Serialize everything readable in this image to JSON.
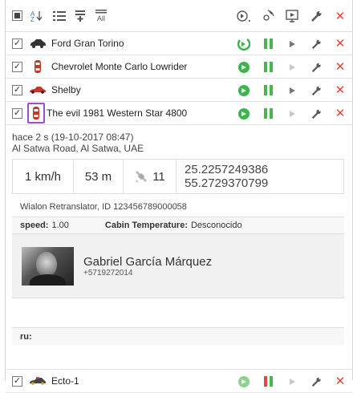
{
  "toolbar": {
    "left_icons": [
      "select-all-checkbox-icon",
      "sort-az-icon",
      "list-icon",
      "group-icon",
      "show-all-icon"
    ],
    "all_label": "All",
    "right_icons": [
      "send-command-icon",
      "sensor-icon",
      "video-icon",
      "settings-icon",
      "delete-icon"
    ]
  },
  "units": [
    {
      "name": "Ford Gran Torino",
      "icon": "car-icon",
      "checked": true
    },
    {
      "name": "Chevrolet Monte Carlo Lowrider",
      "icon": "car-icon",
      "checked": true
    },
    {
      "name": "Shelby",
      "icon": "sports-car-icon",
      "checked": true
    },
    {
      "name": "The evil 1981 Western Star 4800",
      "icon": "truck-icon",
      "checked": true
    },
    {
      "name": "Ecto-1",
      "icon": "car-icon",
      "checked": true
    }
  ],
  "detail": {
    "time": "hace 2 s (19-10-2017 08:47)",
    "address": "Al Satwa Road, Al Satwa, UAE",
    "speed": "1 km/h",
    "altitude": "53 m",
    "satellites": "11",
    "lat": "25.2257249386",
    "lon": "55.2729370799",
    "retranslator": "Wialon Retranslator, ID 123456789000058",
    "param_speed_label": "speed:",
    "param_speed_value": "1.00",
    "param_temp_label": "Cabin Temperature:",
    "param_temp_value": "Desconocido",
    "driver_name": "Gabriel García Márquez",
    "driver_phone": "+5719272014",
    "ru_label": "ru:"
  },
  "colors": {
    "accent_green": "#3bb54a",
    "delete_red": "#e8453c",
    "selection_purple": "#9b4dd6"
  }
}
